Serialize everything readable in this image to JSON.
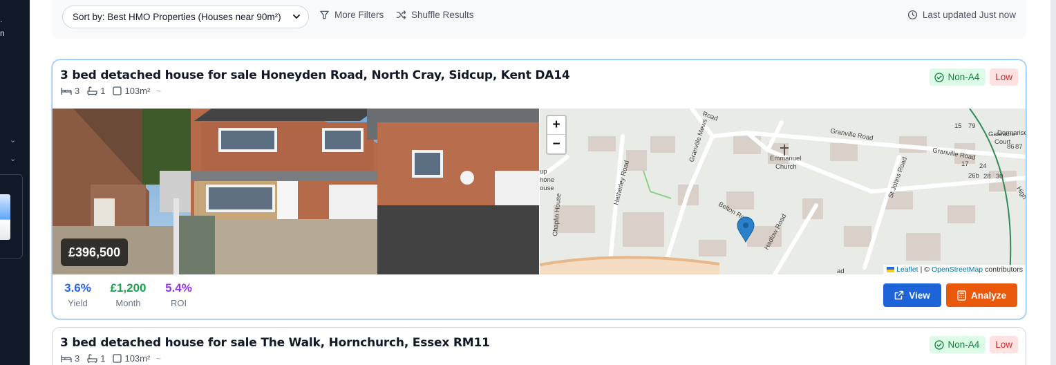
{
  "sidebar": {
    "fragments": [
      ".",
      "n"
    ],
    "chevrons": [
      "⌄",
      "⌄"
    ]
  },
  "toolbar": {
    "sort_value": "Sort by: Best HMO Properties (Houses near 90m²)",
    "more_filters": "More Filters",
    "shuffle": "Shuffle Results",
    "last_updated": "Last updated Just now"
  },
  "listings": [
    {
      "title": "3 bed detached house for sale Honeyden Road, North Cray, Sidcup, Kent DA14",
      "beds": "3",
      "baths": "1",
      "area": "103m²",
      "approx": "~",
      "badge_status": "Non-A4",
      "badge_risk": "Low",
      "price": "£396,500",
      "yield_value": "3.6%",
      "yield_label": "Yield",
      "month_value": "£1,200",
      "month_label": "Month",
      "roi_value": "5.4%",
      "roi_label": "ROI",
      "view_label": "View",
      "analyze_label": "Analyze",
      "map": {
        "zoom_in": "+",
        "zoom_out": "−",
        "attribution_leaflet": "Leaflet",
        "attribution_sep": "| ©",
        "attribution_osm": "OpenStreetMap",
        "attribution_tail": "contributors",
        "labels": {
          "granville_road": "Granville Road",
          "granville_road_2": "Granville Road",
          "granville_mews": "Granville Mews",
          "emmanuel_church": "Emmanuel Church",
          "emmanuel": "Emmanuel",
          "church": "Church",
          "hatherley_road": "Hatherley Road",
          "belton_road": "Belton Road",
          "hadlow_road": "Hadlow Road",
          "st_johns_road": "St Johns Road",
          "chaplin_house": "Chaplin House",
          "gateacre_court": "Gateacre Court",
          "gateacre": "Gateacre",
          "court": "Court",
          "dormarise": "Dormarise",
          "road_top": "Road",
          "up": "up",
          "hone": "hone",
          "ouse": "ouse",
          "high": "High",
          "ad": "ad",
          "n15": "15",
          "n79": "79",
          "n17": "17",
          "n24": "24",
          "n26b": "26b",
          "n28": "28",
          "n30": "30",
          "n86": "86",
          "n87": "87"
        }
      }
    },
    {
      "title": "3 bed detached house for sale The Walk, Hornchurch, Essex RM11",
      "beds": "3",
      "baths": "1",
      "area": "103m²",
      "approx": "~",
      "badge_status": "Non-A4",
      "badge_risk": "Low"
    }
  ],
  "colors": {
    "accent_blue": "#1d64d8",
    "accent_orange": "#ea580c",
    "yield": "#2563eb",
    "month": "#16a34a",
    "roi": "#9333ea",
    "badge_green_bg": "#dcfce7",
    "badge_red_bg": "#fee2e2"
  },
  "icons": [
    "bed-icon",
    "bath-icon",
    "area-icon",
    "check-badge-icon",
    "filter-icon",
    "shuffle-icon",
    "clock-icon",
    "external-link-icon",
    "calculator-icon",
    "chevron-down-icon",
    "map-marker-icon",
    "church-cross-icon"
  ]
}
